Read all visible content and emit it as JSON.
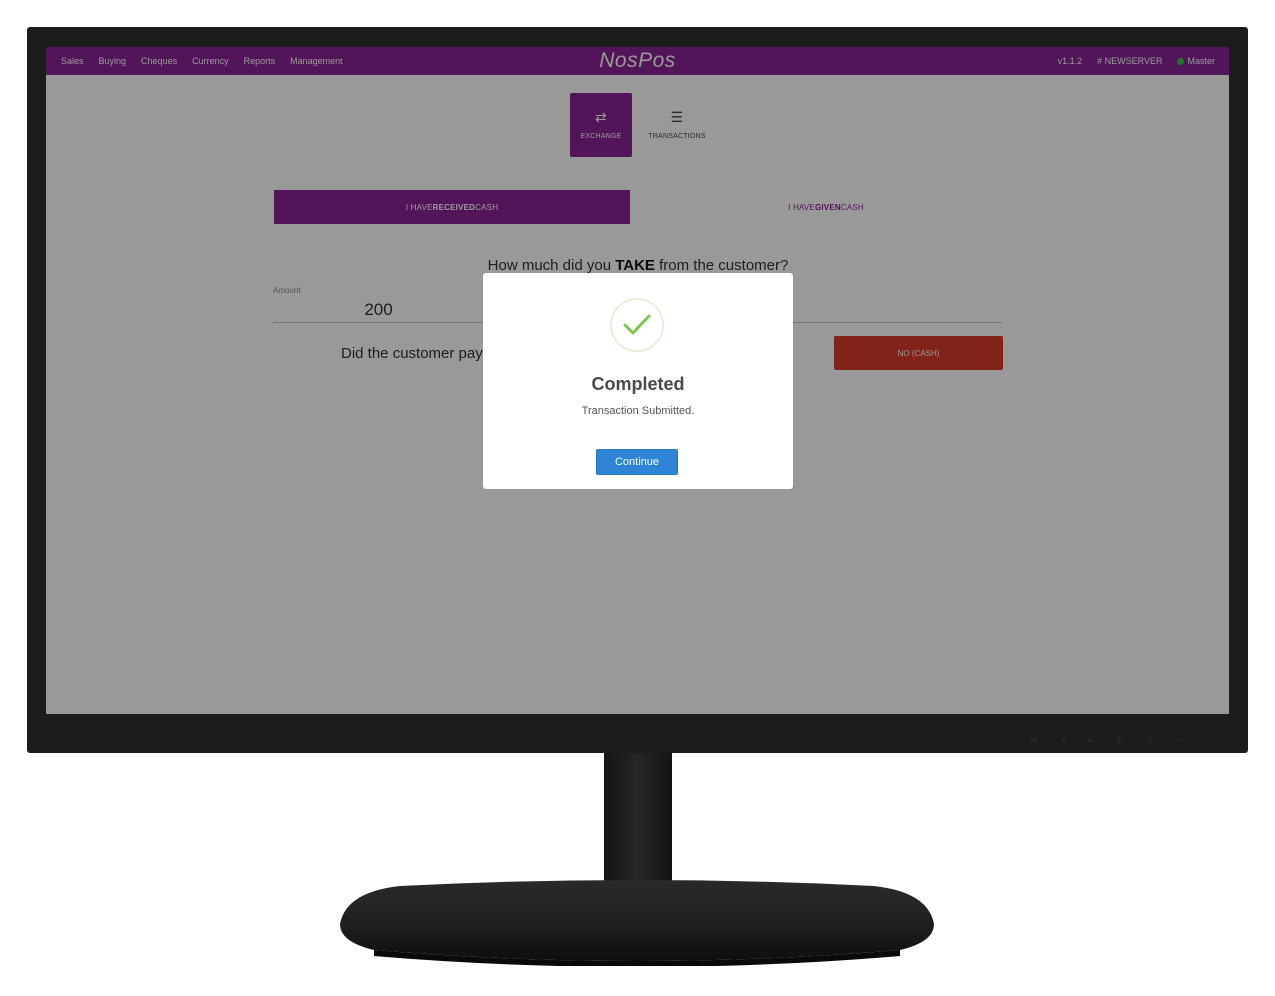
{
  "navbar": {
    "menu": [
      "Sales",
      "Buying",
      "Cheques",
      "Currency",
      "Reports",
      "Management"
    ],
    "brand": "NosPos",
    "version": "v1.1.2",
    "server": "NEWSERVER",
    "user": "Master"
  },
  "tiles": {
    "exchange": {
      "icon": "⇄",
      "label": "EXCHANGE"
    },
    "transactions": {
      "icon": "☰",
      "label": "TRANSACTIONS"
    }
  },
  "toggle": {
    "received_pre": "I HAVE ",
    "received_bold": "RECEIVED",
    "received_post": " CASH",
    "given_pre": "I HAVE ",
    "given_bold": "GIVEN",
    "given_post": " CASH"
  },
  "question": {
    "pre": "How much did you ",
    "bold": "TAKE",
    "post": " from the customer?"
  },
  "amount": {
    "label": "Amount",
    "value": "200"
  },
  "payment": {
    "question": "Did the customer pay",
    "no_button": "NO (CASH)"
  },
  "modal": {
    "title": "Completed",
    "text": "Transaction Submitted.",
    "button": "Continue"
  },
  "monitor": {
    "buttons": [
      "M",
      "◂",
      "▸",
      "E",
      "⏻",
      "•"
    ]
  },
  "colors": {
    "brand_purple": "#8a2396",
    "danger_red": "#d93b2a",
    "continue_blue": "#2f84d6",
    "success_green": "#7ec552"
  }
}
